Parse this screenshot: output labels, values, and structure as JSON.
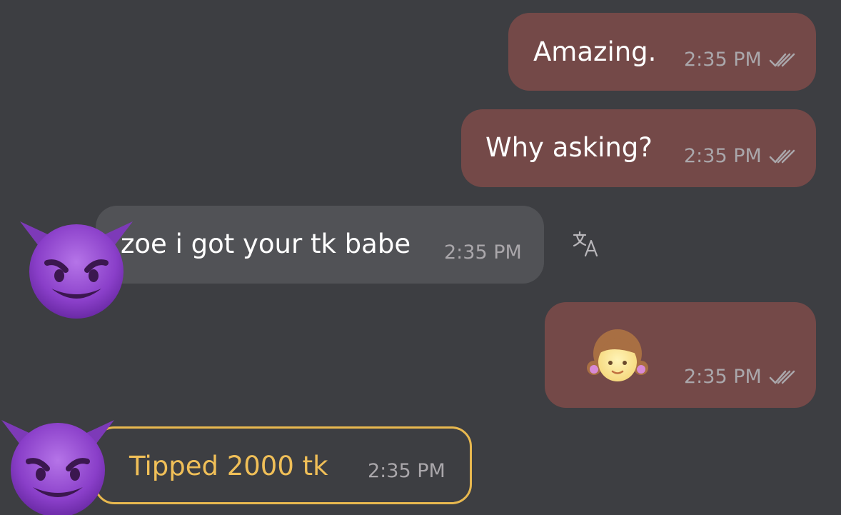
{
  "messages": [
    {
      "direction": "outgoing",
      "text": "Amazing.",
      "time": "2:35 PM",
      "status": "read"
    },
    {
      "direction": "outgoing",
      "text": "Why asking?",
      "time": "2:35 PM",
      "status": "read"
    },
    {
      "direction": "incoming",
      "text": "zoe i got your tk babe",
      "time": "2:35 PM",
      "avatar": "smiling-devil-emoji",
      "action_icon": "translate-icon"
    },
    {
      "direction": "outgoing",
      "emoji": "girl-emoji",
      "time": "2:35 PM",
      "status": "read"
    },
    {
      "direction": "incoming",
      "type": "tip",
      "text": "Tipped 2000 tk",
      "time": "2:35 PM",
      "avatar": "smiling-devil-emoji"
    }
  ],
  "colors": {
    "background": "#3d3e42",
    "outgoing_bubble": "#744948",
    "incoming_bubble": "#515256",
    "tip_accent": "#e8b84f",
    "timestamp": "#aaa7ab"
  }
}
